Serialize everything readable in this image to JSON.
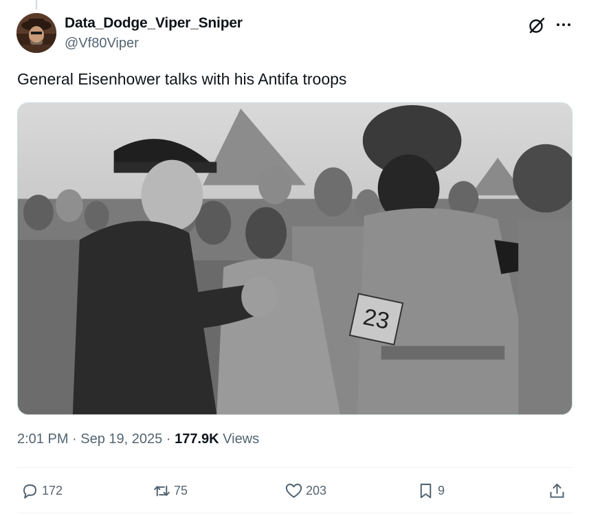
{
  "tweet": {
    "author": {
      "display_name": "Data_Dodge_Viper_Sniper",
      "handle": "@Vf80Viper"
    },
    "text": "General Eisenhower talks with his Antifa troops",
    "media": {
      "patch_number": "23"
    },
    "meta": {
      "time": "2:01 PM",
      "sep1": "·",
      "date": "Sep 19, 2025",
      "sep2": "·",
      "views_count": "177.9K",
      "views_label": "Views"
    },
    "actions": {
      "replies": "172",
      "reposts": "75",
      "likes": "203",
      "bookmarks": "9"
    }
  },
  "icons": {
    "grok": "grok-icon",
    "more": "more-icon",
    "reply": "reply-icon",
    "repost": "repost-icon",
    "like": "heart-icon",
    "bookmark": "bookmark-icon",
    "share": "share-icon"
  },
  "colors": {
    "text_primary": "#0f1419",
    "text_secondary": "#536471",
    "border": "#cfd9de"
  }
}
